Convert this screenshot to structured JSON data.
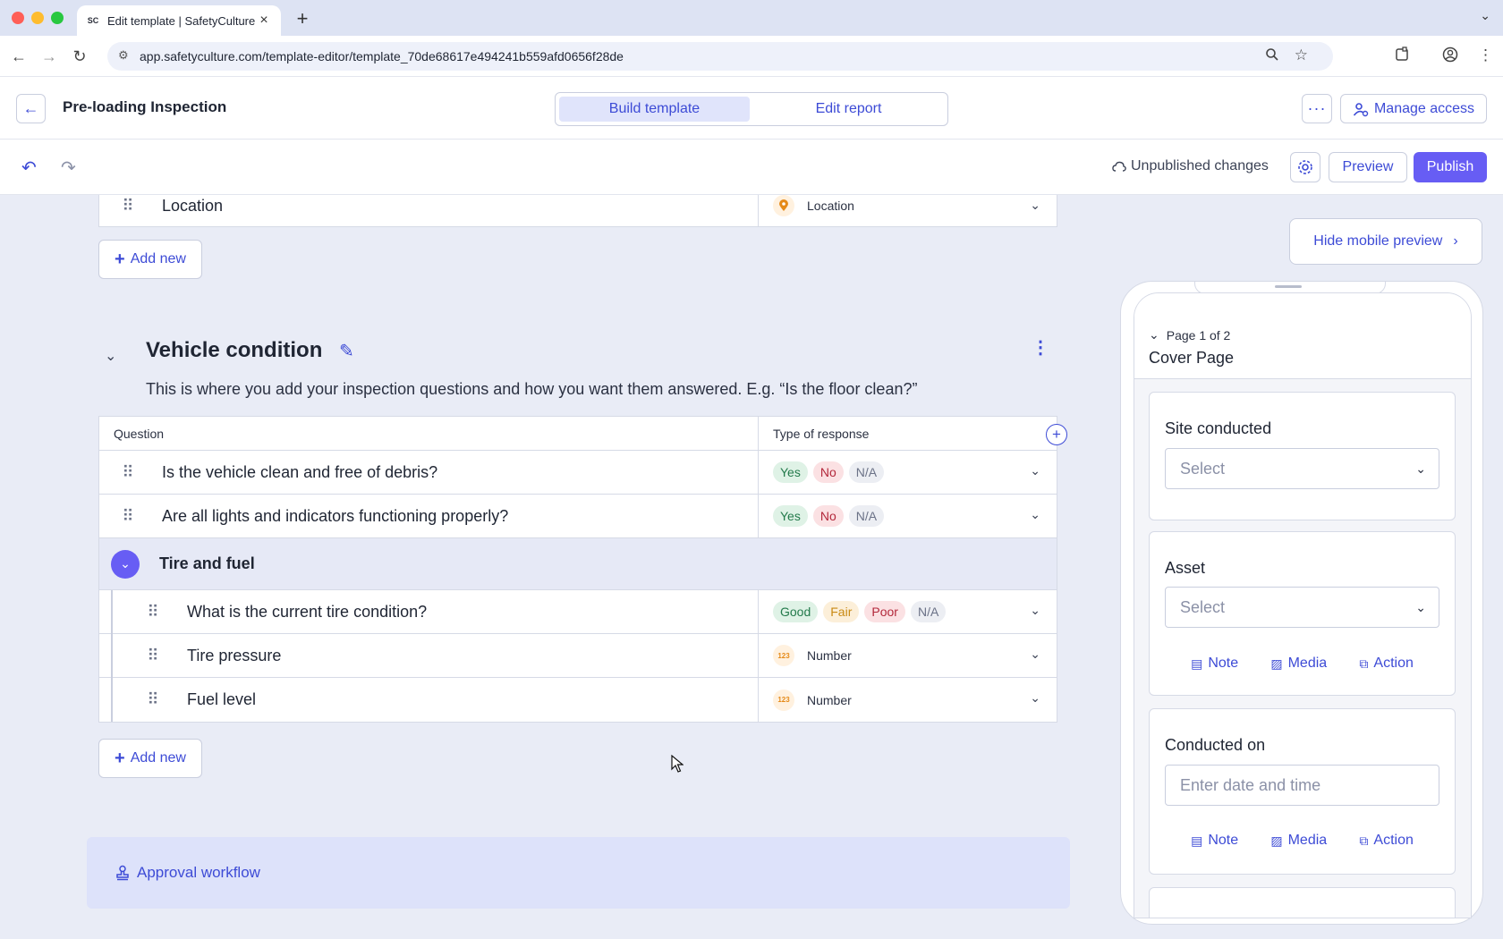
{
  "browser": {
    "tab_title": "Edit template | SafetyCulture",
    "tab_favicon": "SC",
    "url": "app.safetyculture.com/template-editor/template_70de68617e494241b559afd0656f28de"
  },
  "header": {
    "template_name": "Pre-loading Inspection",
    "tabs": [
      "Build template",
      "Edit report"
    ],
    "manage_access": "Manage access"
  },
  "toolbar": {
    "status": "Unpublished changes",
    "preview": "Preview",
    "publish": "Publish"
  },
  "location_row": {
    "question": "Location",
    "response": "Location"
  },
  "add_new_label": "Add new",
  "section": {
    "title": "Vehicle condition",
    "description": "This is where you add your inspection questions and how you want them answered. E.g. “Is the floor clean?”",
    "col_question": "Question",
    "col_response": "Type of response",
    "questions": [
      {
        "text": "Is the vehicle clean and free of debris?",
        "responses": [
          "Yes",
          "No",
          "N/A"
        ]
      },
      {
        "text": "Are all lights and indicators functioning properly?",
        "responses": [
          "Yes",
          "No",
          "N/A"
        ]
      }
    ],
    "group": {
      "title": "Tire and fuel",
      "items": [
        {
          "text": "What is the current tire condition?",
          "responses": [
            "Good",
            "Fair",
            "Poor",
            "N/A"
          ]
        },
        {
          "text": "Tire pressure",
          "response_type": "Number",
          "icon_text": "123"
        },
        {
          "text": "Fuel level",
          "response_type": "Number",
          "icon_text": "123"
        }
      ]
    }
  },
  "approval_workflow": "Approval workflow",
  "mobile_preview": {
    "hide_label": "Hide mobile preview",
    "page_indicator": "Page 1 of 2",
    "page_title": "Cover Page",
    "fields": [
      {
        "label": "Site conducted",
        "placeholder": "Select"
      },
      {
        "label": "Asset",
        "placeholder": "Select"
      },
      {
        "label": "Conducted on",
        "placeholder": "Enter date and time"
      }
    ],
    "actions": [
      "Note",
      "Media",
      "Action"
    ]
  },
  "colors": {
    "accent": "#3d4bd6",
    "publish": "#675df4",
    "canvas": "#e9ecf6"
  }
}
